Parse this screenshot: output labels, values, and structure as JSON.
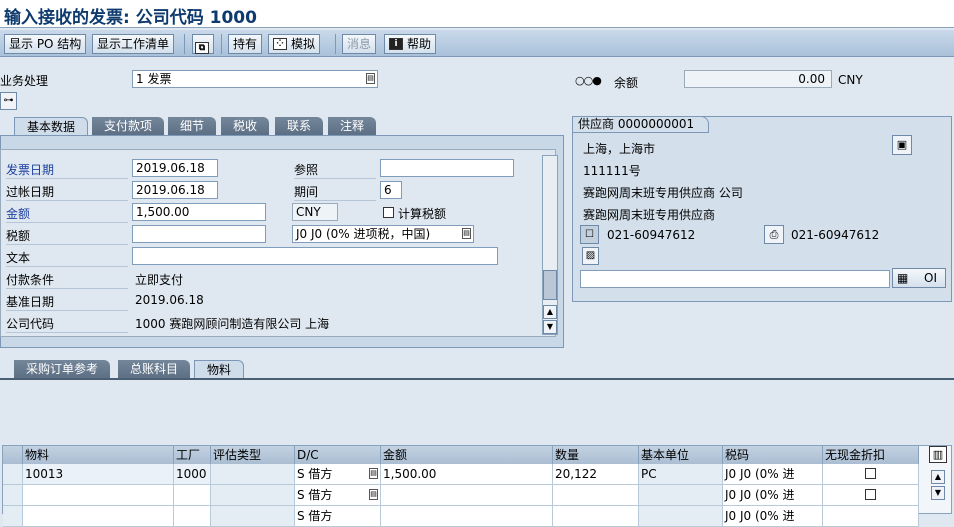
{
  "window": {
    "title": "输入接收的发票: 公司代码 1000"
  },
  "toolbar": {
    "show_po_structure": "显示 PO 结构",
    "show_worklist": "显示工作清单",
    "hold": "持有",
    "simulate": "模拟",
    "messages": "消息",
    "help": "帮助"
  },
  "header": {
    "transaction_label": "业务处理",
    "transaction_value": "1 发票",
    "balance_label": "余额",
    "balance_value": "0.00",
    "balance_currency": "CNY"
  },
  "tabs": {
    "basic_data": "基本数据",
    "payment": "支付款项",
    "details": "细节",
    "tax": "税收",
    "contacts": "联系",
    "notes": "注释"
  },
  "basic": {
    "invoice_date_label": "发票日期",
    "invoice_date": "2019.06.18",
    "reference_label": "参照",
    "reference": "",
    "posting_date_label": "过帐日期",
    "posting_date": "2019.06.18",
    "period_label": "期间",
    "period": "6",
    "amount_label": "金额",
    "amount": "1,500.00",
    "currency": "CNY",
    "calc_tax_label": "计算税额",
    "tax_amount_label": "税额",
    "tax_amount": "",
    "tax_code": "J0 J0 (0% 进项税，中国)",
    "text_label": "文本",
    "text": "",
    "payment_terms_label": "付款条件",
    "payment_terms": "立即支付",
    "baseline_date_label": "基准日期",
    "baseline_date": "2019.06.18",
    "company_code_label": "公司代码",
    "company_code": "1000 赛跑网顾问制造有限公司 上海"
  },
  "vendor": {
    "tab": "供应商 0000000001",
    "city": "上海，上海市",
    "address": "111111号",
    "name1": "赛跑网周末班专用供应商 公司",
    "name2": "赛跑网周末班专用供应商",
    "phone": "021-60947612",
    "fax": "021-60947612",
    "oi_button": "OI"
  },
  "lower_tabs": {
    "po_ref": "采购订单参考",
    "gl_account": "总账科目",
    "material": "物料"
  },
  "grid": {
    "headers": [
      "物料",
      "工厂",
      "评估类型",
      "D/C",
      "金额",
      "数量",
      "基本单位",
      "税码",
      "无现金折扣"
    ],
    "rows": [
      {
        "material": "10013",
        "plant": "1000",
        "val_type": "",
        "dc": "S 借方",
        "amount": "1,500.00",
        "qty": "20,122",
        "unit": "PC",
        "tax": "J0 J0 (0% 进"
      },
      {
        "material": "",
        "plant": "",
        "val_type": "",
        "dc": "S 借方",
        "amount": "",
        "qty": "",
        "unit": "",
        "tax": "J0 J0 (0% 进"
      },
      {
        "material": "",
        "plant": "",
        "val_type": "",
        "dc": "S 借方",
        "amount": "",
        "qty": "",
        "unit": "",
        "tax": "J0 J0 (0% 进"
      }
    ]
  },
  "colors": {
    "title": "#0e3a6e",
    "toolbar": "#b9cde1",
    "panel": "#c9d8e6",
    "label_blue": "#1d3f9e"
  }
}
